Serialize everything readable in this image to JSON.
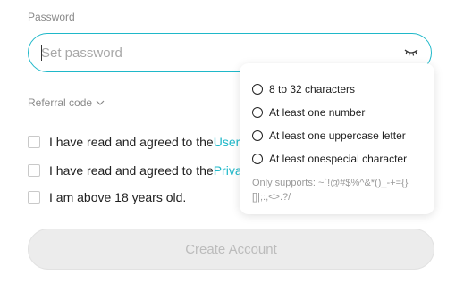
{
  "password": {
    "label": "Password",
    "placeholder": "Set password",
    "value": ""
  },
  "referral": {
    "label": "Referral code"
  },
  "agreements": [
    {
      "prefix": "I have read and agreed to the ",
      "link": "User"
    },
    {
      "prefix": "I have read and agreed to the ",
      "link": "Priva"
    },
    {
      "prefix": "I am above 18 years old.",
      "link": ""
    }
  ],
  "create_button": {
    "label": "Create Account"
  },
  "password_rules": {
    "items": [
      "8 to 32 characters",
      "At least one number",
      "At least one uppercase letter",
      "At least onespecial character"
    ],
    "supports": "Only supports: ~`!@#$%^&*()_-+={}[]|;:,<>.?/"
  },
  "colors": {
    "accent": "#1fb8c9",
    "disabled_bg": "#ececec",
    "muted_text": "#8a8a8a"
  },
  "icons": {
    "password_toggle": "eye-closed-icon",
    "referral_toggle": "chevron-down-icon"
  }
}
